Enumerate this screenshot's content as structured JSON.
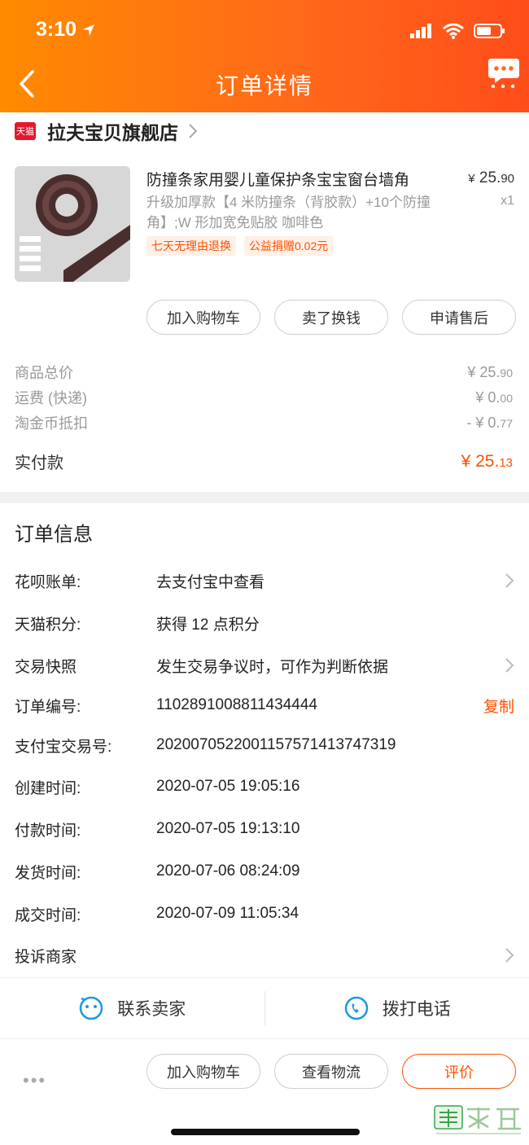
{
  "status_bar": {
    "time": "3:10"
  },
  "nav": {
    "title": "订单详情"
  },
  "store": {
    "badge": "天猫",
    "name": "拉夫宝贝旗舰店"
  },
  "product": {
    "title": "防撞条家用婴儿童保护条宝宝窗台墙角",
    "sku": "升级加厚款【4 米防撞条（背胶款）+10个防撞角】;W 形加宽免贴胶 咖啡色",
    "price_symbol": "¥",
    "price_int": "25.",
    "price_dec": "90",
    "qty": "x1",
    "tags": [
      "七天无理由退换",
      "公益捐赠0.02元"
    ],
    "image_label": "W型-咖啡色"
  },
  "item_actions": [
    "加入购物车",
    "卖了换钱",
    "申请售后"
  ],
  "summary": [
    {
      "label": "商品总价",
      "value": "¥ 25.",
      "dec": "90"
    },
    {
      "label": "运费 (快递)",
      "value": "¥ 0.",
      "dec": "00"
    },
    {
      "label": "淘金币抵扣",
      "value": "- ¥ 0.",
      "dec": "77"
    }
  ],
  "total": {
    "label": "实付款",
    "value": "¥ 25.",
    "dec": "13"
  },
  "order_info": {
    "title": "订单信息",
    "rows": [
      {
        "label": "花呗账单:",
        "value": "去支付宝中查看"
      },
      {
        "label": "天猫积分:",
        "value": "获得 12 点积分"
      },
      {
        "label": "交易快照",
        "value": "发生交易争议时，可作为判断依据"
      },
      {
        "label": "订单编号:",
        "value": "1102891008811434444",
        "action": "复制"
      },
      {
        "label": "支付宝交易号:",
        "value": "2020070522001157571413747319"
      },
      {
        "label": "创建时间:",
        "value": "2020-07-05 19:05:16"
      },
      {
        "label": "付款时间:",
        "value": "2020-07-05 19:13:10"
      },
      {
        "label": "发货时间:",
        "value": "2020-07-06 08:24:09"
      },
      {
        "label": "成交时间:",
        "value": "2020-07-09 11:05:34"
      },
      {
        "label": "投诉商家",
        "value": ""
      }
    ]
  },
  "contact": {
    "seller": "联系卖家",
    "phone": "拨打电话"
  },
  "bottom_bar": {
    "more": "•••",
    "buttons": [
      "加入购物车",
      "查看物流",
      "评价"
    ]
  },
  "watermark": {
    "text": "集诚信",
    "sub": "JiChengXin.com"
  },
  "colors": {
    "accent": "#ff5000",
    "header_start": "#ff8a00",
    "header_end": "#ff4d1a",
    "icon_blue": "#1a9be0"
  }
}
